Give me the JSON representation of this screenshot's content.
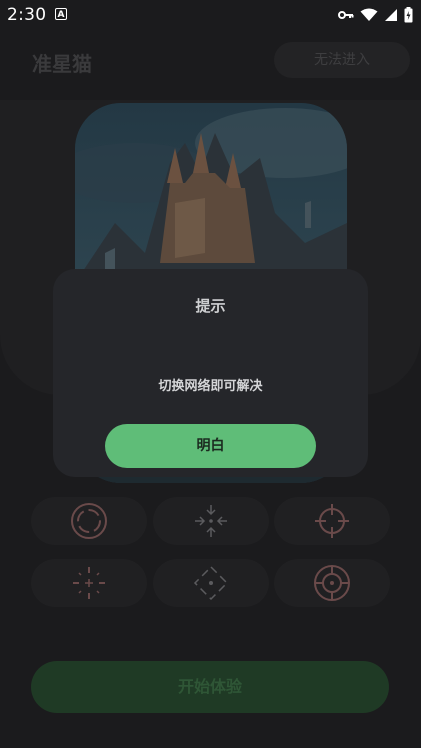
{
  "status_bar": {
    "time": "2:30",
    "notification_glyph": "A",
    "icons": [
      "key-icon",
      "wifi-icon",
      "signal-icon",
      "battery-icon"
    ]
  },
  "header": {
    "app_title": "准星猫",
    "enter_button": "无法进入"
  },
  "artwork": {
    "icon": "castle-artwork"
  },
  "crosshairs": {
    "items": [
      {
        "icon": "crosshair-ring-icon"
      },
      {
        "icon": "crosshair-arrows-in-icon"
      },
      {
        "icon": "crosshair-scope-icon"
      },
      {
        "icon": "crosshair-ticks-icon"
      },
      {
        "icon": "crosshair-diamond-icon"
      },
      {
        "icon": "crosshair-target-icon"
      }
    ]
  },
  "start_button": "开始体验",
  "dialog": {
    "title": "提示",
    "message": "切换网络即可解决",
    "confirm": "明白"
  },
  "colors": {
    "accent": "#5fbd78",
    "dialog_bg": "#25262a",
    "page_bg": "#1b1b1d"
  }
}
